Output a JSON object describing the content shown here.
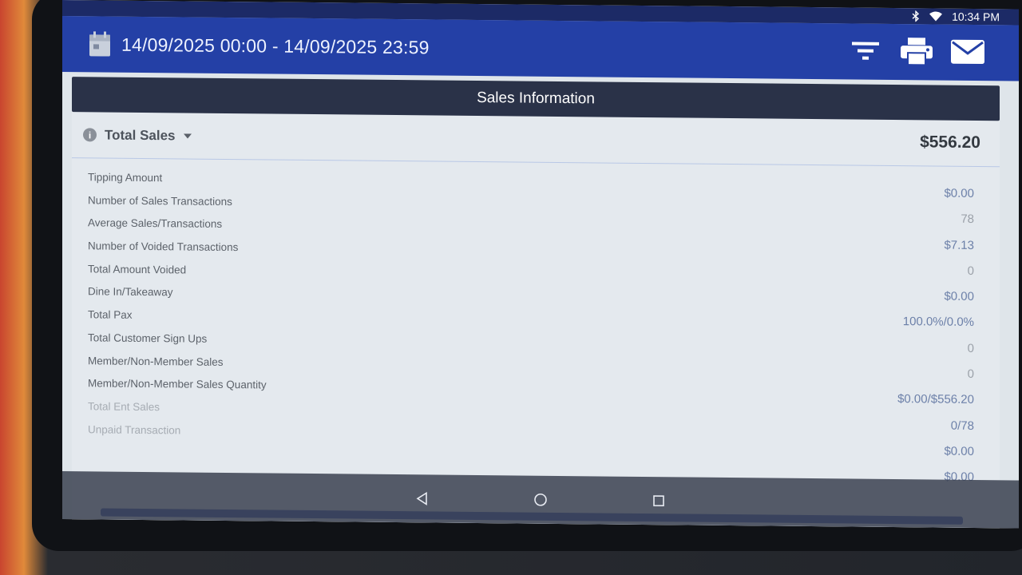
{
  "status_bar": {
    "time": "10:34 PM",
    "icons": [
      "bluetooth-icon",
      "wifi-icon"
    ]
  },
  "header": {
    "date_range": "14/09/2025 00:00 - 14/09/2025 23:59",
    "icons": [
      "calendar-icon",
      "filter-icon",
      "print-icon",
      "email-icon"
    ]
  },
  "section": {
    "title": "Sales Information"
  },
  "summary": {
    "label": "Total Sales",
    "value": "$556.20"
  },
  "rows": {
    "labels": [
      "Tipping Amount",
      "Number of Sales Transactions",
      "Average Sales/Transactions",
      "Number of Voided Transactions",
      "Total Amount Voided",
      "Dine In/Takeaway",
      "Total Pax",
      "Total Customer Sign Ups",
      "Member/Non-Member Sales",
      "Member/Non-Member Sales Quantity",
      "Total Ent Sales",
      "Unpaid Transaction"
    ],
    "values": [
      "$0.00",
      "78",
      "$7.13",
      "0",
      "$0.00",
      "100.0%/0.0%",
      "0",
      "0",
      "$0.00/$556.20",
      "0/78",
      "$0.00",
      "$0.00"
    ]
  },
  "colors": {
    "header": "#2440a6",
    "status_bar": "#1c2a66",
    "section_bar": "#2a3248",
    "value_text": "#6b7fa8"
  }
}
